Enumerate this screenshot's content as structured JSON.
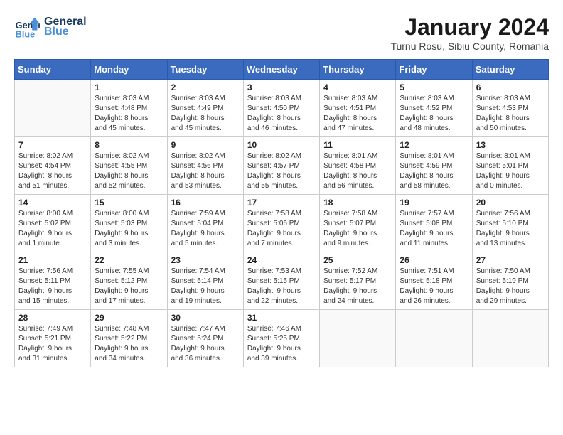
{
  "header": {
    "logo_line1": "General",
    "logo_line2": "Blue",
    "month": "January 2024",
    "location": "Turnu Rosu, Sibiu County, Romania"
  },
  "weekdays": [
    "Sunday",
    "Monday",
    "Tuesday",
    "Wednesday",
    "Thursday",
    "Friday",
    "Saturday"
  ],
  "weeks": [
    [
      {
        "day": "",
        "info": ""
      },
      {
        "day": "1",
        "info": "Sunrise: 8:03 AM\nSunset: 4:48 PM\nDaylight: 8 hours\nand 45 minutes."
      },
      {
        "day": "2",
        "info": "Sunrise: 8:03 AM\nSunset: 4:49 PM\nDaylight: 8 hours\nand 45 minutes."
      },
      {
        "day": "3",
        "info": "Sunrise: 8:03 AM\nSunset: 4:50 PM\nDaylight: 8 hours\nand 46 minutes."
      },
      {
        "day": "4",
        "info": "Sunrise: 8:03 AM\nSunset: 4:51 PM\nDaylight: 8 hours\nand 47 minutes."
      },
      {
        "day": "5",
        "info": "Sunrise: 8:03 AM\nSunset: 4:52 PM\nDaylight: 8 hours\nand 48 minutes."
      },
      {
        "day": "6",
        "info": "Sunrise: 8:03 AM\nSunset: 4:53 PM\nDaylight: 8 hours\nand 50 minutes."
      }
    ],
    [
      {
        "day": "7",
        "info": "Sunrise: 8:02 AM\nSunset: 4:54 PM\nDaylight: 8 hours\nand 51 minutes."
      },
      {
        "day": "8",
        "info": "Sunrise: 8:02 AM\nSunset: 4:55 PM\nDaylight: 8 hours\nand 52 minutes."
      },
      {
        "day": "9",
        "info": "Sunrise: 8:02 AM\nSunset: 4:56 PM\nDaylight: 8 hours\nand 53 minutes."
      },
      {
        "day": "10",
        "info": "Sunrise: 8:02 AM\nSunset: 4:57 PM\nDaylight: 8 hours\nand 55 minutes."
      },
      {
        "day": "11",
        "info": "Sunrise: 8:01 AM\nSunset: 4:58 PM\nDaylight: 8 hours\nand 56 minutes."
      },
      {
        "day": "12",
        "info": "Sunrise: 8:01 AM\nSunset: 4:59 PM\nDaylight: 8 hours\nand 58 minutes."
      },
      {
        "day": "13",
        "info": "Sunrise: 8:01 AM\nSunset: 5:01 PM\nDaylight: 9 hours\nand 0 minutes."
      }
    ],
    [
      {
        "day": "14",
        "info": "Sunrise: 8:00 AM\nSunset: 5:02 PM\nDaylight: 9 hours\nand 1 minute."
      },
      {
        "day": "15",
        "info": "Sunrise: 8:00 AM\nSunset: 5:03 PM\nDaylight: 9 hours\nand 3 minutes."
      },
      {
        "day": "16",
        "info": "Sunrise: 7:59 AM\nSunset: 5:04 PM\nDaylight: 9 hours\nand 5 minutes."
      },
      {
        "day": "17",
        "info": "Sunrise: 7:58 AM\nSunset: 5:06 PM\nDaylight: 9 hours\nand 7 minutes."
      },
      {
        "day": "18",
        "info": "Sunrise: 7:58 AM\nSunset: 5:07 PM\nDaylight: 9 hours\nand 9 minutes."
      },
      {
        "day": "19",
        "info": "Sunrise: 7:57 AM\nSunset: 5:08 PM\nDaylight: 9 hours\nand 11 minutes."
      },
      {
        "day": "20",
        "info": "Sunrise: 7:56 AM\nSunset: 5:10 PM\nDaylight: 9 hours\nand 13 minutes."
      }
    ],
    [
      {
        "day": "21",
        "info": "Sunrise: 7:56 AM\nSunset: 5:11 PM\nDaylight: 9 hours\nand 15 minutes."
      },
      {
        "day": "22",
        "info": "Sunrise: 7:55 AM\nSunset: 5:12 PM\nDaylight: 9 hours\nand 17 minutes."
      },
      {
        "day": "23",
        "info": "Sunrise: 7:54 AM\nSunset: 5:14 PM\nDaylight: 9 hours\nand 19 minutes."
      },
      {
        "day": "24",
        "info": "Sunrise: 7:53 AM\nSunset: 5:15 PM\nDaylight: 9 hours\nand 22 minutes."
      },
      {
        "day": "25",
        "info": "Sunrise: 7:52 AM\nSunset: 5:17 PM\nDaylight: 9 hours\nand 24 minutes."
      },
      {
        "day": "26",
        "info": "Sunrise: 7:51 AM\nSunset: 5:18 PM\nDaylight: 9 hours\nand 26 minutes."
      },
      {
        "day": "27",
        "info": "Sunrise: 7:50 AM\nSunset: 5:19 PM\nDaylight: 9 hours\nand 29 minutes."
      }
    ],
    [
      {
        "day": "28",
        "info": "Sunrise: 7:49 AM\nSunset: 5:21 PM\nDaylight: 9 hours\nand 31 minutes."
      },
      {
        "day": "29",
        "info": "Sunrise: 7:48 AM\nSunset: 5:22 PM\nDaylight: 9 hours\nand 34 minutes."
      },
      {
        "day": "30",
        "info": "Sunrise: 7:47 AM\nSunset: 5:24 PM\nDaylight: 9 hours\nand 36 minutes."
      },
      {
        "day": "31",
        "info": "Sunrise: 7:46 AM\nSunset: 5:25 PM\nDaylight: 9 hours\nand 39 minutes."
      },
      {
        "day": "",
        "info": ""
      },
      {
        "day": "",
        "info": ""
      },
      {
        "day": "",
        "info": ""
      }
    ]
  ]
}
